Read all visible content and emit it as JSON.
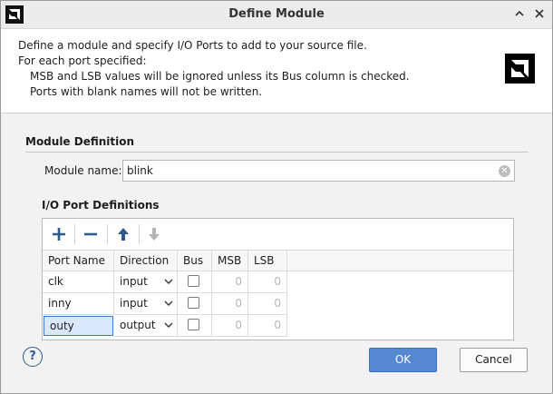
{
  "window": {
    "title": "Define Module"
  },
  "header": {
    "line1": "Define a module and specify I/O Ports to add to your source file.",
    "line2": "For each port specified:",
    "line3": "MSB and LSB values will be ignored unless its Bus column is checked.",
    "line4": "Ports with blank names will not be written."
  },
  "module": {
    "section_title": "Module Definition",
    "name_label": "Module name:",
    "name_value": "blink"
  },
  "io": {
    "section_title": "I/O Port Definitions",
    "columns": [
      "Port Name",
      "Direction",
      "Bus",
      "MSB",
      "LSB"
    ],
    "rows": [
      {
        "name": "clk",
        "direction": "input",
        "bus": false,
        "msb": "0",
        "lsb": "0"
      },
      {
        "name": "inny",
        "direction": "input",
        "bus": false,
        "msb": "0",
        "lsb": "0"
      },
      {
        "name": "outy",
        "direction": "output",
        "bus": false,
        "msb": "0",
        "lsb": "0"
      }
    ],
    "toolbar": [
      "add-icon",
      "remove-icon",
      "move-up-icon",
      "move-down-icon"
    ]
  },
  "buttons": {
    "help": "?",
    "ok": "OK",
    "cancel": "Cancel"
  },
  "colors": {
    "accent": "#5688d2",
    "selection": "#3d78d8"
  }
}
